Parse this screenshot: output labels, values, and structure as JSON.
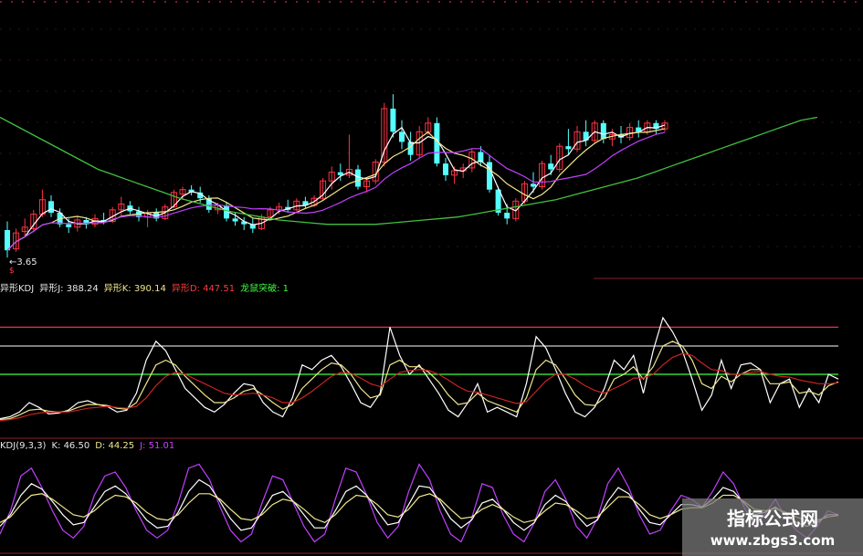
{
  "chart_data": [
    {
      "type": "candlestick",
      "annotation_low": "3.65",
      "annotation_marker": "$",
      "ma_colors": [
        "#ffffff",
        "#f0e68c",
        "#c040ff",
        "#40c040"
      ],
      "candles": [
        {
          "o": 3.84,
          "h": 3.9,
          "l": 3.65,
          "c": 3.7,
          "up": false
        },
        {
          "o": 3.71,
          "h": 3.85,
          "l": 3.69,
          "c": 3.82,
          "up": true
        },
        {
          "o": 3.83,
          "h": 3.92,
          "l": 3.8,
          "c": 3.86,
          "up": true
        },
        {
          "o": 3.85,
          "h": 3.98,
          "l": 3.83,
          "c": 3.95,
          "up": true
        },
        {
          "o": 3.95,
          "h": 4.12,
          "l": 3.93,
          "c": 4.05,
          "up": true
        },
        {
          "o": 4.04,
          "h": 4.08,
          "l": 3.93,
          "c": 3.96,
          "up": false
        },
        {
          "o": 3.96,
          "h": 3.99,
          "l": 3.86,
          "c": 3.88,
          "up": false
        },
        {
          "o": 3.88,
          "h": 3.92,
          "l": 3.82,
          "c": 3.86,
          "up": false
        },
        {
          "o": 3.86,
          "h": 3.94,
          "l": 3.83,
          "c": 3.91,
          "up": true
        },
        {
          "o": 3.91,
          "h": 3.93,
          "l": 3.85,
          "c": 3.88,
          "up": false
        },
        {
          "o": 3.88,
          "h": 3.95,
          "l": 3.86,
          "c": 3.92,
          "up": true
        },
        {
          "o": 3.91,
          "h": 3.96,
          "l": 3.88,
          "c": 3.9,
          "up": false
        },
        {
          "o": 3.9,
          "h": 4.0,
          "l": 3.89,
          "c": 3.98,
          "up": true
        },
        {
          "o": 3.98,
          "h": 4.07,
          "l": 3.94,
          "c": 4.02,
          "up": true
        },
        {
          "o": 4.01,
          "h": 4.04,
          "l": 3.95,
          "c": 3.97,
          "up": false
        },
        {
          "o": 3.97,
          "h": 4.0,
          "l": 3.9,
          "c": 3.93,
          "up": false
        },
        {
          "o": 3.93,
          "h": 3.98,
          "l": 3.86,
          "c": 3.96,
          "up": true
        },
        {
          "o": 3.96,
          "h": 3.99,
          "l": 3.9,
          "c": 3.92,
          "up": false
        },
        {
          "o": 3.92,
          "h": 4.02,
          "l": 3.91,
          "c": 4.0,
          "up": true
        },
        {
          "o": 4.0,
          "h": 4.12,
          "l": 3.99,
          "c": 4.1,
          "up": true
        },
        {
          "o": 4.09,
          "h": 4.14,
          "l": 4.05,
          "c": 4.12,
          "up": true
        },
        {
          "o": 4.12,
          "h": 4.15,
          "l": 4.08,
          "c": 4.1,
          "up": false
        },
        {
          "o": 4.1,
          "h": 4.14,
          "l": 4.03,
          "c": 4.06,
          "up": false
        },
        {
          "o": 4.06,
          "h": 4.08,
          "l": 3.96,
          "c": 3.98,
          "up": false
        },
        {
          "o": 3.98,
          "h": 4.03,
          "l": 3.95,
          "c": 4.01,
          "up": true
        },
        {
          "o": 4.01,
          "h": 4.03,
          "l": 3.9,
          "c": 3.92,
          "up": false
        },
        {
          "o": 3.92,
          "h": 3.96,
          "l": 3.87,
          "c": 3.9,
          "up": false
        },
        {
          "o": 3.9,
          "h": 3.93,
          "l": 3.84,
          "c": 3.88,
          "up": false
        },
        {
          "o": 3.88,
          "h": 3.92,
          "l": 3.82,
          "c": 3.85,
          "up": false
        },
        {
          "o": 3.85,
          "h": 3.95,
          "l": 3.84,
          "c": 3.93,
          "up": true
        },
        {
          "o": 3.93,
          "h": 4.0,
          "l": 3.92,
          "c": 3.98,
          "up": true
        },
        {
          "o": 3.98,
          "h": 4.03,
          "l": 3.95,
          "c": 4.0,
          "up": true
        },
        {
          "o": 4.0,
          "h": 4.05,
          "l": 3.96,
          "c": 3.98,
          "up": false
        },
        {
          "o": 3.98,
          "h": 4.06,
          "l": 3.97,
          "c": 4.04,
          "up": true
        },
        {
          "o": 4.04,
          "h": 4.07,
          "l": 3.99,
          "c": 4.01,
          "up": false
        },
        {
          "o": 4.01,
          "h": 4.08,
          "l": 4.0,
          "c": 4.06,
          "up": true
        },
        {
          "o": 4.06,
          "h": 4.2,
          "l": 4.04,
          "c": 4.18,
          "up": true
        },
        {
          "o": 4.18,
          "h": 4.28,
          "l": 4.12,
          "c": 4.24,
          "up": true
        },
        {
          "o": 4.24,
          "h": 4.3,
          "l": 4.18,
          "c": 4.22,
          "up": false
        },
        {
          "o": 4.22,
          "h": 4.5,
          "l": 4.2,
          "c": 4.26,
          "up": true
        },
        {
          "o": 4.26,
          "h": 4.29,
          "l": 4.12,
          "c": 4.14,
          "up": false
        },
        {
          "o": 4.14,
          "h": 4.2,
          "l": 4.1,
          "c": 4.18,
          "up": true
        },
        {
          "o": 4.18,
          "h": 4.33,
          "l": 4.16,
          "c": 4.31,
          "up": true
        },
        {
          "o": 4.31,
          "h": 4.72,
          "l": 4.28,
          "c": 4.68,
          "up": true
        },
        {
          "o": 4.68,
          "h": 4.78,
          "l": 4.48,
          "c": 4.52,
          "up": false
        },
        {
          "o": 4.52,
          "h": 4.6,
          "l": 4.4,
          "c": 4.45,
          "up": false
        },
        {
          "o": 4.45,
          "h": 4.52,
          "l": 4.32,
          "c": 4.36,
          "up": false
        },
        {
          "o": 4.36,
          "h": 4.56,
          "l": 4.34,
          "c": 4.52,
          "up": true
        },
        {
          "o": 4.52,
          "h": 4.62,
          "l": 4.5,
          "c": 4.58,
          "up": true
        },
        {
          "o": 4.58,
          "h": 4.62,
          "l": 4.28,
          "c": 4.3,
          "up": false
        },
        {
          "o": 4.3,
          "h": 4.34,
          "l": 4.18,
          "c": 4.22,
          "up": false
        },
        {
          "o": 4.22,
          "h": 4.28,
          "l": 4.16,
          "c": 4.25,
          "up": true
        },
        {
          "o": 4.25,
          "h": 4.3,
          "l": 4.2,
          "c": 4.27,
          "up": true
        },
        {
          "o": 4.27,
          "h": 4.4,
          "l": 4.24,
          "c": 4.38,
          "up": true
        },
        {
          "o": 4.38,
          "h": 4.42,
          "l": 4.28,
          "c": 4.31,
          "up": false
        },
        {
          "o": 4.31,
          "h": 4.36,
          "l": 4.1,
          "c": 4.12,
          "up": false
        },
        {
          "o": 4.12,
          "h": 4.14,
          "l": 3.94,
          "c": 3.96,
          "up": false
        },
        {
          "o": 3.96,
          "h": 4.02,
          "l": 3.88,
          "c": 3.92,
          "up": false
        },
        {
          "o": 3.92,
          "h": 4.06,
          "l": 3.9,
          "c": 4.04,
          "up": true
        },
        {
          "o": 4.04,
          "h": 4.18,
          "l": 4.02,
          "c": 4.16,
          "up": true
        },
        {
          "o": 4.16,
          "h": 4.24,
          "l": 4.1,
          "c": 4.14,
          "up": false
        },
        {
          "o": 4.14,
          "h": 4.32,
          "l": 4.12,
          "c": 4.3,
          "up": true
        },
        {
          "o": 4.3,
          "h": 4.36,
          "l": 4.22,
          "c": 4.26,
          "up": false
        },
        {
          "o": 4.26,
          "h": 4.44,
          "l": 4.24,
          "c": 4.42,
          "up": true
        },
        {
          "o": 4.42,
          "h": 4.54,
          "l": 4.36,
          "c": 4.4,
          "up": false
        },
        {
          "o": 4.4,
          "h": 4.56,
          "l": 4.38,
          "c": 4.52,
          "up": true
        },
        {
          "o": 4.52,
          "h": 4.6,
          "l": 4.42,
          "c": 4.46,
          "up": false
        },
        {
          "o": 4.46,
          "h": 4.6,
          "l": 4.44,
          "c": 4.58,
          "up": true
        },
        {
          "o": 4.58,
          "h": 4.6,
          "l": 4.44,
          "c": 4.47,
          "up": false
        },
        {
          "o": 4.47,
          "h": 4.54,
          "l": 4.42,
          "c": 4.5,
          "up": true
        },
        {
          "o": 4.5,
          "h": 4.56,
          "l": 4.44,
          "c": 4.48,
          "up": false
        },
        {
          "o": 4.48,
          "h": 4.58,
          "l": 4.46,
          "c": 4.55,
          "up": true
        },
        {
          "o": 4.55,
          "h": 4.6,
          "l": 4.48,
          "c": 4.52,
          "up": false
        },
        {
          "o": 4.52,
          "h": 4.6,
          "l": 4.5,
          "c": 4.58,
          "up": true
        },
        {
          "o": 4.58,
          "h": 4.6,
          "l": 4.5,
          "c": 4.54,
          "up": false
        },
        {
          "o": 4.54,
          "h": 4.6,
          "l": 4.52,
          "c": 4.58,
          "up": true
        }
      ],
      "ma_long": [
        4.62,
        4.56,
        4.5,
        4.44,
        4.38,
        4.32,
        4.26,
        4.22,
        4.18,
        4.14,
        4.1,
        4.06,
        4.03,
        4.0,
        3.97,
        3.95,
        3.93,
        3.91,
        3.9,
        3.89,
        3.88,
        3.88,
        3.88,
        3.88,
        3.89,
        3.9,
        3.91,
        3.92,
        3.93,
        3.95,
        3.97,
        3.99,
        4.01,
        4.03,
        4.05,
        4.08,
        4.11,
        4.14,
        4.17,
        4.2,
        4.24,
        4.28,
        4.32,
        4.36,
        4.4,
        4.44,
        4.48,
        4.52,
        4.56,
        4.6,
        4.62
      ]
    },
    {
      "type": "line",
      "header": {
        "name_a": "异形KDJ",
        "j_label": "异形J: 388.24",
        "k_label": "异形K: 390.14",
        "d_label": "异形D: 447.51",
        "signal_label": "龙鼠突破: 1"
      },
      "levels": [
        {
          "value": 100,
          "color": "#ff3b5a"
        },
        {
          "value": 80,
          "color": "#cccccc"
        },
        {
          "value": 50,
          "color": "#40ff40"
        }
      ],
      "ylim": [
        -10,
        110
      ],
      "series": [
        {
          "color": "#ffffff",
          "values": [
            3,
            5,
            10,
            20,
            15,
            8,
            9,
            12,
            20,
            22,
            18,
            16,
            10,
            12,
            30,
            65,
            85,
            75,
            55,
            35,
            25,
            15,
            10,
            18,
            30,
            40,
            38,
            20,
            10,
            5,
            25,
            60,
            55,
            65,
            70,
            58,
            40,
            20,
            15,
            30,
            100,
            70,
            50,
            60,
            45,
            30,
            12,
            5,
            20,
            40,
            10,
            15,
            10,
            5,
            40,
            90,
            78,
            55,
            30,
            10,
            5,
            15,
            35,
            65,
            55,
            70,
            30,
            75,
            110,
            95,
            75,
            45,
            12,
            28,
            65,
            35,
            60,
            62,
            55,
            20,
            40,
            45,
            15,
            35,
            20,
            50,
            45
          ]
        },
        {
          "color": "#f0e68c",
          "values": [
            2,
            3,
            7,
            12,
            13,
            11,
            10,
            11,
            15,
            18,
            18,
            17,
            14,
            13,
            20,
            40,
            60,
            65,
            60,
            48,
            38,
            28,
            20,
            20,
            25,
            32,
            35,
            28,
            20,
            13,
            18,
            35,
            45,
            55,
            62,
            60,
            50,
            35,
            25,
            28,
            60,
            65,
            58,
            58,
            52,
            42,
            28,
            18,
            20,
            30,
            22,
            18,
            14,
            10,
            25,
            55,
            65,
            60,
            45,
            28,
            18,
            17,
            25,
            45,
            50,
            58,
            45,
            58,
            80,
            85,
            80,
            65,
            40,
            35,
            48,
            42,
            50,
            55,
            55,
            40,
            40,
            42,
            30,
            32,
            28,
            38,
            42
          ]
        },
        {
          "color": "#cc2222",
          "values": [
            1,
            2,
            4,
            7,
            9,
            10,
            10,
            10,
            12,
            14,
            15,
            16,
            15,
            14,
            16,
            25,
            38,
            48,
            52,
            50,
            45,
            40,
            35,
            30,
            28,
            29,
            30,
            28,
            25,
            20,
            20,
            25,
            32,
            40,
            48,
            52,
            51,
            46,
            40,
            37,
            45,
            52,
            54,
            55,
            54,
            50,
            44,
            37,
            32,
            31,
            28,
            25,
            22,
            19,
            21,
            32,
            43,
            50,
            50,
            45,
            38,
            33,
            30,
            35,
            40,
            46,
            46,
            50,
            60,
            68,
            72,
            70,
            62,
            55,
            54,
            50,
            50,
            52,
            53,
            50,
            48,
            47,
            44,
            42,
            40,
            40,
            41
          ]
        }
      ]
    },
    {
      "type": "line",
      "header": {
        "title": "KDJ(9,3,3)",
        "k_label": "K: 46.50",
        "d_label": "D: 44.25",
        "j_label": "J: 51.01"
      },
      "ylim": [
        -10,
        110
      ],
      "series": [
        {
          "color": "#c040ff",
          "values": [
            10,
            40,
            85,
            95,
            70,
            40,
            15,
            5,
            20,
            60,
            85,
            90,
            70,
            40,
            15,
            5,
            15,
            50,
            95,
            100,
            80,
            45,
            15,
            0,
            10,
            50,
            85,
            80,
            50,
            20,
            0,
            10,
            55,
            95,
            90,
            60,
            25,
            5,
            20,
            65,
            100,
            80,
            40,
            10,
            0,
            30,
            75,
            70,
            35,
            10,
            0,
            25,
            65,
            80,
            55,
            20,
            5,
            30,
            75,
            95,
            70,
            35,
            10,
            15,
            40,
            60,
            55,
            45,
            65,
            90,
            75,
            45,
            20,
            35,
            55,
            30,
            15,
            5,
            20,
            40,
            35
          ]
        },
        {
          "color": "#ffffff",
          "values": [
            20,
            35,
            60,
            75,
            68,
            52,
            35,
            22,
            25,
            45,
            65,
            72,
            62,
            45,
            28,
            18,
            20,
            38,
            65,
            80,
            72,
            52,
            30,
            15,
            18,
            38,
            60,
            65,
            52,
            35,
            18,
            18,
            40,
            65,
            72,
            60,
            40,
            22,
            25,
            48,
            72,
            70,
            52,
            30,
            18,
            28,
            50,
            55,
            42,
            25,
            15,
            25,
            48,
            60,
            52,
            35,
            20,
            28,
            52,
            70,
            62,
            42,
            25,
            22,
            35,
            48,
            48,
            45,
            55,
            70,
            65,
            50,
            35,
            38,
            45,
            35,
            25,
            20,
            25,
            35,
            35
          ]
        },
        {
          "color": "#f0e68c",
          "values": [
            25,
            32,
            48,
            60,
            62,
            55,
            45,
            35,
            32,
            40,
            52,
            60,
            58,
            50,
            38,
            30,
            28,
            35,
            50,
            62,
            62,
            55,
            42,
            30,
            28,
            35,
            48,
            55,
            52,
            42,
            30,
            25,
            35,
            50,
            60,
            58,
            48,
            35,
            32,
            42,
            58,
            62,
            55,
            42,
            30,
            32,
            42,
            48,
            42,
            32,
            25,
            28,
            40,
            50,
            48,
            40,
            30,
            32,
            45,
            58,
            58,
            48,
            35,
            30,
            35,
            42,
            44,
            44,
            50,
            60,
            60,
            52,
            42,
            40,
            43,
            38,
            32,
            27,
            28,
            32,
            34
          ]
        }
      ]
    }
  ],
  "watermark": {
    "title": "指标公式网",
    "url": "www.zbgs3.com"
  }
}
